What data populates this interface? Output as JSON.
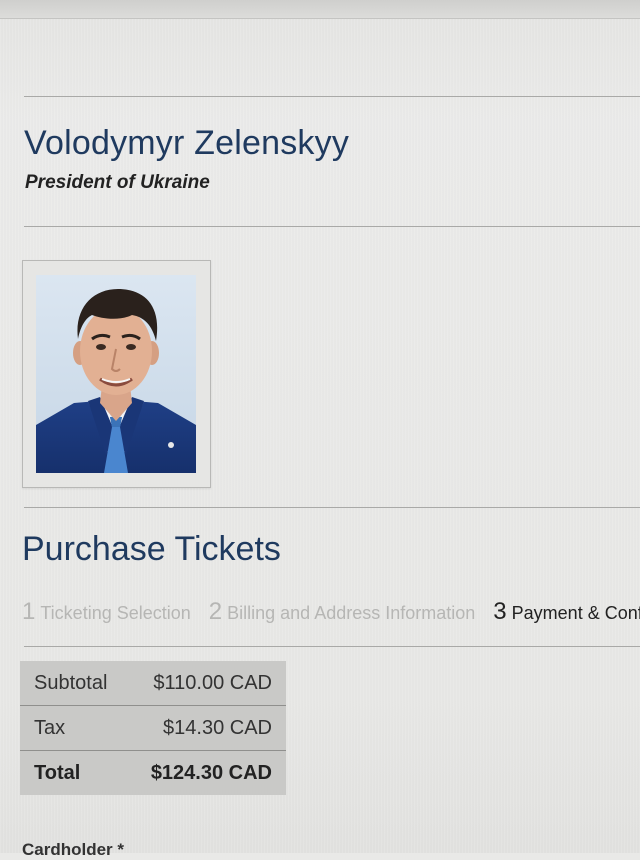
{
  "speaker": {
    "name": "Volodymyr Zelenskyy",
    "title": "President of Ukraine"
  },
  "purchase": {
    "heading": "Purchase Tickets",
    "steps": [
      {
        "number": "1",
        "label": "Ticketing Selection",
        "active": false
      },
      {
        "number": "2",
        "label": "Billing and Address Information",
        "active": false
      },
      {
        "number": "3",
        "label": "Payment & Confirmation",
        "active": true
      }
    ],
    "summary": [
      {
        "label": "Subtotal",
        "amount": "$110.00 CAD"
      },
      {
        "label": "Tax",
        "amount": "$14.30 CAD"
      },
      {
        "label": "Total",
        "amount": "$124.30 CAD"
      }
    ],
    "cardholder_label": "Cardholder *"
  },
  "colors": {
    "heading": "#1f3a5f",
    "inactive_step": "#b6b6b4",
    "summary_bg": "#c9c9c7"
  }
}
